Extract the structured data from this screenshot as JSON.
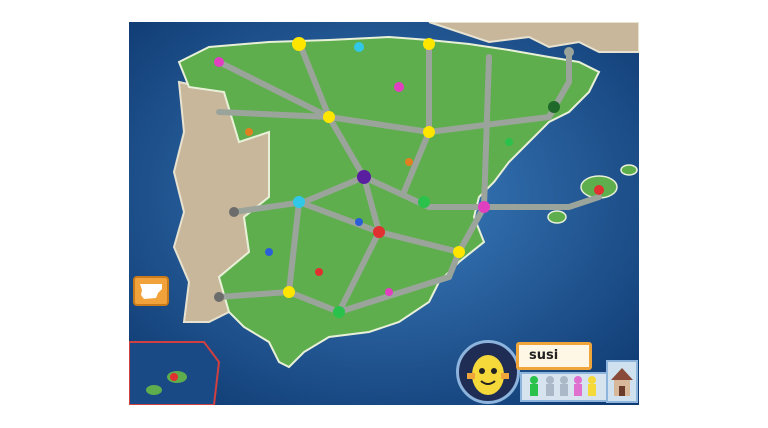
{
  "player": {
    "name": "susi"
  },
  "icons": {
    "spain_button": "spain-map-icon",
    "home_button": "house-icon",
    "avatar": "banana-character-icon"
  },
  "colors": {
    "sea": "#1d4f8c",
    "land_spain": "#5fae4d",
    "land_other": "#c8b79a",
    "path": "#9aa49a",
    "accent": "#f0a53a"
  }
}
